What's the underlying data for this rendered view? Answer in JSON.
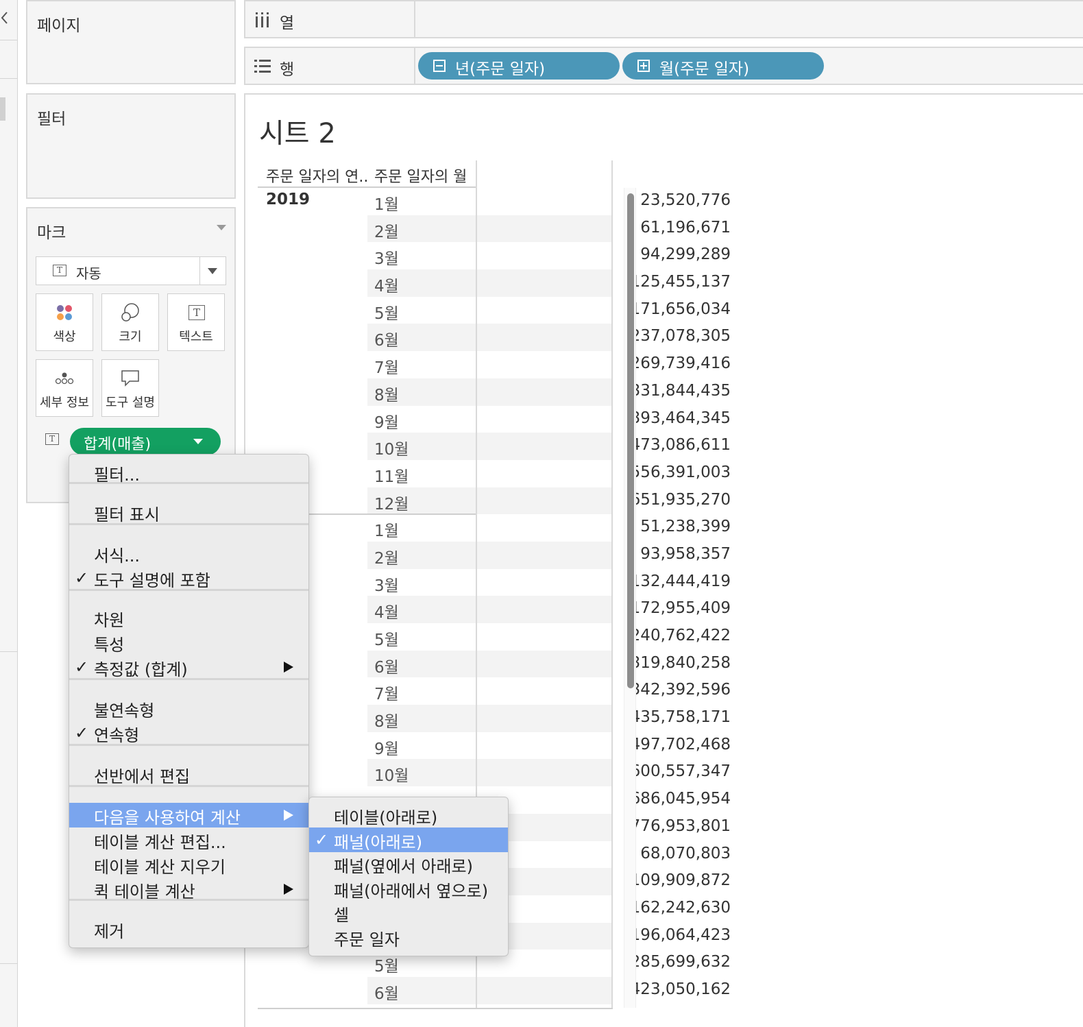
{
  "left_panes": {
    "pages_title": "페이지",
    "filters_title": "필터",
    "marks_title": "마크",
    "mark_type": "자동",
    "mark_buttons": [
      {
        "label": "색상",
        "icon": "color-dots-icon"
      },
      {
        "label": "크기",
        "icon": "size-icon"
      },
      {
        "label": "텍스트",
        "icon": "text-icon"
      },
      {
        "label": "세부 정보",
        "icon": "detail-icon"
      },
      {
        "label": "도구 설명",
        "icon": "tooltip-icon"
      }
    ],
    "measure_pill": "합계(매출)"
  },
  "shelves": {
    "columns_label": "열",
    "rows_label": "행",
    "row_pills": [
      "년(주문 일자)",
      "월(주문 일자)"
    ]
  },
  "view": {
    "sheet_title": "시트 2",
    "header_year": "주문 일자의 연..",
    "header_month": "주문 일자의 월",
    "year": "2019",
    "rows": [
      {
        "m": "1월",
        "v": "23,520,776"
      },
      {
        "m": "2월",
        "v": "61,196,671"
      },
      {
        "m": "3월",
        "v": "94,299,289"
      },
      {
        "m": "4월",
        "v": "125,455,137"
      },
      {
        "m": "5월",
        "v": "171,656,034"
      },
      {
        "m": "6월",
        "v": "237,078,305"
      },
      {
        "m": "7월",
        "v": "269,739,416"
      },
      {
        "m": "8월",
        "v": "331,844,435"
      },
      {
        "m": "9월",
        "v": "393,464,345"
      },
      {
        "m": "10월",
        "v": "473,086,611"
      },
      {
        "m": "11월",
        "v": "556,391,003"
      },
      {
        "m": "12월",
        "v": "651,935,270"
      },
      {
        "m": "1월",
        "v": "51,238,399"
      },
      {
        "m": "2월",
        "v": "93,958,357"
      },
      {
        "m": "3월",
        "v": "132,444,419"
      },
      {
        "m": "4월",
        "v": "172,955,409"
      },
      {
        "m": "5월",
        "v": "240,762,422"
      },
      {
        "m": "6월",
        "v": "319,840,258"
      },
      {
        "m": "7월",
        "v": "342,392,596"
      },
      {
        "m": "8월",
        "v": "435,758,171"
      },
      {
        "m": "9월",
        "v": "497,702,468"
      },
      {
        "m": "10월",
        "v": "600,557,347"
      },
      {
        "m": "",
        "v": "686,045,954"
      },
      {
        "m": "",
        "v": "776,953,801"
      },
      {
        "m": "",
        "v": "68,070,803"
      },
      {
        "m": "",
        "v": "109,909,872"
      },
      {
        "m": "",
        "v": "162,242,630"
      },
      {
        "m": "",
        "v": "196,064,423"
      },
      {
        "m": "5월",
        "v": "285,699,632"
      },
      {
        "m": "6월",
        "v": "423,050,162"
      }
    ]
  },
  "context_menu": {
    "items": [
      {
        "label": "필터...",
        "checked": false,
        "submenu": false
      },
      {
        "label": "필터 표시",
        "checked": false,
        "submenu": false
      },
      {
        "label": "서식...",
        "checked": false,
        "submenu": false
      },
      {
        "label": "도구 설명에 포함",
        "checked": true,
        "submenu": false
      },
      {
        "label": "차원",
        "checked": false,
        "submenu": false
      },
      {
        "label": "특성",
        "checked": false,
        "submenu": false
      },
      {
        "label": "측정값 (합계)",
        "checked": true,
        "submenu": true
      },
      {
        "label": "불연속형",
        "checked": false,
        "submenu": false
      },
      {
        "label": "연속형",
        "checked": true,
        "submenu": false
      },
      {
        "label": "선반에서 편집",
        "checked": false,
        "submenu": false
      },
      {
        "label": "다음을 사용하여 계산",
        "checked": false,
        "submenu": true,
        "highlighted": true
      },
      {
        "label": "테이블 계산 편집...",
        "checked": false,
        "submenu": false
      },
      {
        "label": "테이블 계산 지우기",
        "checked": false,
        "submenu": false
      },
      {
        "label": "퀵 테이블 계산",
        "checked": false,
        "submenu": true
      },
      {
        "label": "제거",
        "checked": false,
        "submenu": false
      }
    ],
    "check_glyph": "✓"
  },
  "submenu": {
    "items": [
      {
        "label": "테이블(아래로)",
        "checked": false
      },
      {
        "label": "패널(아래로)",
        "checked": true,
        "highlighted": true
      },
      {
        "label": "패널(옆에서 아래로)",
        "checked": false
      },
      {
        "label": "패널(아래에서 옆으로)",
        "checked": false
      },
      {
        "label": "셀",
        "checked": false
      },
      {
        "label": "주문 일자",
        "checked": false
      }
    ]
  },
  "colors": {
    "measure_pill": "#13a061",
    "dimension_pill": "#4b97b8",
    "menu_highlight": "#7aa5ee"
  }
}
